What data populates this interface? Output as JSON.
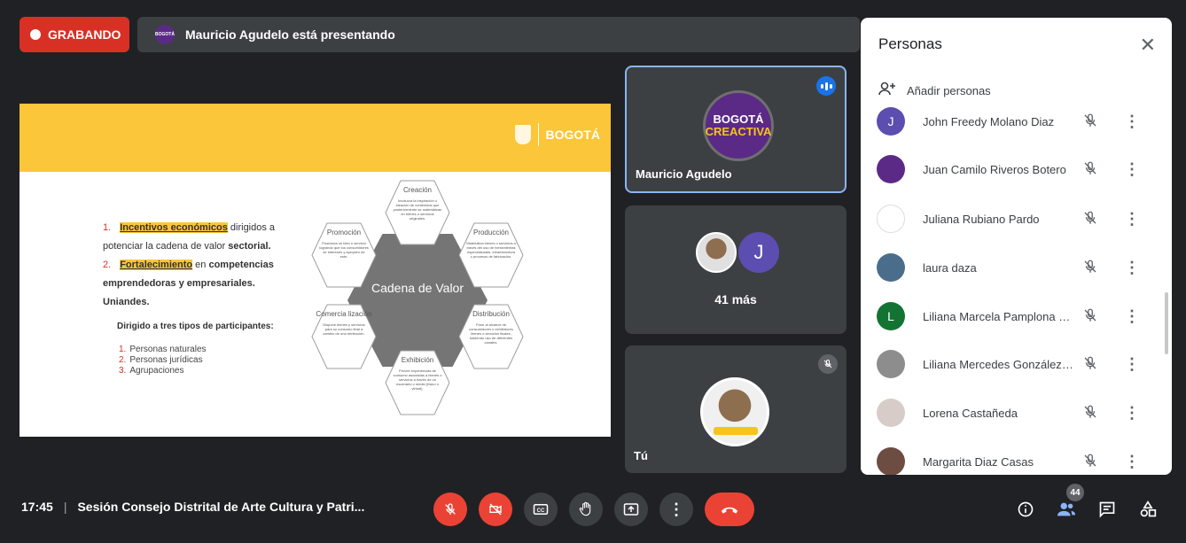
{
  "recording": {
    "label": "GRABANDO"
  },
  "presenting": {
    "text": "Mauricio Agudelo está presentando",
    "logo_text": "BOGOTÁ CREACTIVA"
  },
  "slide": {
    "logo_text": "BOGOTÁ",
    "item1_highlight": "Incentivos económicos",
    "item1_rest": " dirigidos a potenciar la cadena de valor ",
    "item1_bold": "sectorial.",
    "item2_highlight": "Fortalecimiento",
    "item2_rest": " en ",
    "item2_bold": "competencias emprendedoras y empresariales. Uniandes.",
    "dirigido": "Dirigido a tres tipos de participantes:",
    "participants": [
      "Personas naturales",
      "Personas jurídicas",
      "Agrupaciones"
    ],
    "center": "Cadena de Valor",
    "hexes": [
      {
        "title": "Creación",
        "desc": "Involucra la inspiración o ideación de contenidos que posteriormente se materializan en bienes o servicios originales."
      },
      {
        "title": "Producción",
        "desc": "Materializa bienes o servicios a través del uso de herramientas especializadas, infraestructura o procesos de fabricación."
      },
      {
        "title": "Distribución",
        "desc": "Pone al alcance de consumidores o exhibidores bienes o servicios finales, haciendo uso de diferentes canales."
      },
      {
        "title": "Exhibición",
        "desc": "Provee experiencias de consumo asociadas a bienes o servicios a través de un escenario o medio (físico o virtual)."
      },
      {
        "title": "Comercia lización",
        "desc": "Dispone bienes y servicios para su consumo final a cambio de una retribución."
      },
      {
        "title": "Promoción",
        "desc": "Posiciona un bien o servicio logrando que los consumidores se interesen y apropien de este."
      }
    ]
  },
  "tiles": {
    "presenter_name": "Mauricio Agudelo",
    "presenter_avatar_line1": "BOGOTÁ",
    "presenter_avatar_line2": "CREACTIVA",
    "others_avatar_letter": "J",
    "others_label": "41 más",
    "self_name": "Tú"
  },
  "panel": {
    "title": "Personas",
    "add_label": "Añadir personas",
    "people": [
      {
        "name": "John Freedy Molano Diaz",
        "avatar": "J",
        "color": "#5c4db1"
      },
      {
        "name": "Juan Camilo Riveros Botero",
        "avatar": "",
        "color": "#5b2a86"
      },
      {
        "name": "Juliana Rubiano Pardo",
        "avatar": "",
        "color": "#ffffff"
      },
      {
        "name": "laura daza",
        "avatar": "",
        "color": "#4a6d8c"
      },
      {
        "name": "Liliana Marcela Pamplona Villa",
        "avatar": "L",
        "color": "#137333"
      },
      {
        "name": "Liliana Mercedes González Ruiz",
        "avatar": "",
        "color": "#8d8d8d"
      },
      {
        "name": "Lorena Castañeda",
        "avatar": "",
        "color": "#d7ccc8"
      },
      {
        "name": "Margarita Diaz Casas",
        "avatar": "",
        "color": "#6d4c41"
      }
    ]
  },
  "bottom": {
    "time": "17:45",
    "meeting_title": "Sesión Consejo Distrital de Arte Cultura y Patri...",
    "participants_count": "44"
  }
}
